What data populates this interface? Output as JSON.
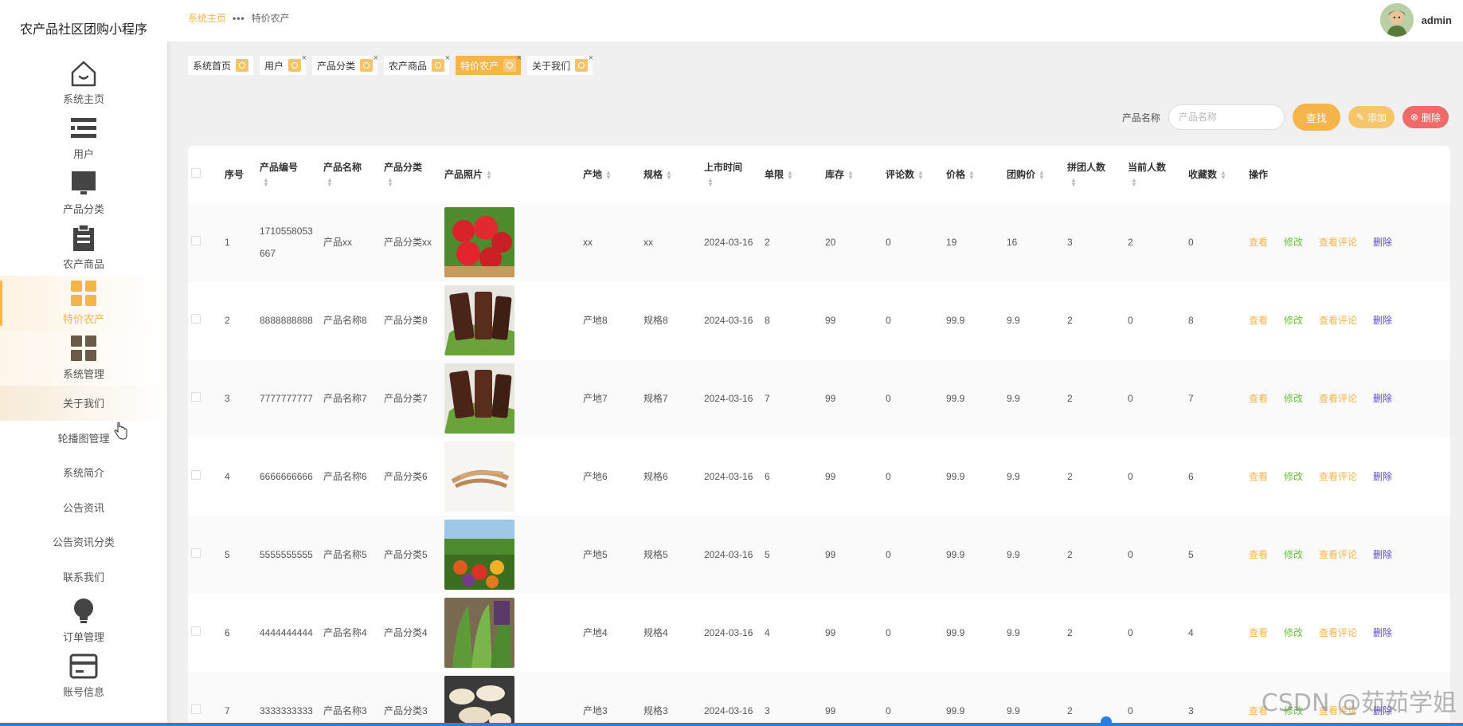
{
  "app": {
    "title": "农产品社区团购小程序"
  },
  "sidebar": {
    "items": [
      {
        "label": "系统主页",
        "icon": "home-icon"
      },
      {
        "label": "用户",
        "icon": "list-icon"
      },
      {
        "label": "产品分类",
        "icon": "monitor-icon"
      },
      {
        "label": "农产商品",
        "icon": "clipboard-icon"
      },
      {
        "label": "特价农产",
        "icon": "grid-icon",
        "active": true
      },
      {
        "label": "系统管理",
        "icon": "grid-icon"
      }
    ],
    "submenu": [
      "关于我们",
      "轮播图管理",
      "系统简介",
      "公告资讯",
      "公告资讯分类",
      "联系我们"
    ],
    "bottom": [
      {
        "label": "订单管理",
        "icon": "bulb-icon"
      },
      {
        "label": "账号信息",
        "icon": "card-icon"
      }
    ]
  },
  "breadcrumb": {
    "home": "系统主页",
    "current": "特价农产"
  },
  "user": {
    "name": "admin"
  },
  "tags": [
    "系统首页",
    "用户",
    "产品分类",
    "农产商品",
    "特价农产",
    "关于我们"
  ],
  "search": {
    "label": "产品名称",
    "placeholder": "产品名称",
    "find": "查找",
    "add": "添加",
    "delete": "删除"
  },
  "table": {
    "headers": [
      "序号",
      "产品编号",
      "产品名称",
      "产品分类",
      "产品照片",
      "产地",
      "规格",
      "上市时间",
      "单限",
      "库存",
      "评论数",
      "价格",
      "团购价",
      "拼团人数",
      "当前人数",
      "收藏数",
      "操作"
    ],
    "actions": [
      "查看",
      "修改",
      "查看评论",
      "删除"
    ],
    "rows": [
      {
        "no": "1",
        "code": "1710558053667",
        "name": "产品xx",
        "category": "产品分类xx",
        "photo": "strawberry",
        "origin": "xx",
        "spec": "xx",
        "date": "2024-03-16",
        "limit": "2",
        "stock": "20",
        "comments": "0",
        "price": "19",
        "group_price": "16",
        "group_size": "3",
        "current": "2",
        "favorites": "0"
      },
      {
        "no": "2",
        "code": "8888888888",
        "name": "产品名称8",
        "category": "产品分类8",
        "photo": "dried-meat",
        "origin": "产地8",
        "spec": "规格8",
        "date": "2024-03-16",
        "limit": "8",
        "stock": "99",
        "comments": "0",
        "price": "99.9",
        "group_price": "9.9",
        "group_size": "2",
        "current": "0",
        "favorites": "8"
      },
      {
        "no": "3",
        "code": "7777777777",
        "name": "产品名称7",
        "category": "产品分类7",
        "photo": "dried-meat",
        "origin": "产地7",
        "spec": "规格7",
        "date": "2024-03-16",
        "limit": "7",
        "stock": "99",
        "comments": "0",
        "price": "99.9",
        "group_price": "9.9",
        "group_size": "2",
        "current": "0",
        "favorites": "7"
      },
      {
        "no": "4",
        "code": "6666666666",
        "name": "产品名称6",
        "category": "产品分类6",
        "photo": "roots",
        "origin": "产地6",
        "spec": "规格6",
        "date": "2024-03-16",
        "limit": "6",
        "stock": "99",
        "comments": "0",
        "price": "99.9",
        "group_price": "9.9",
        "group_size": "2",
        "current": "0",
        "favorites": "6"
      },
      {
        "no": "5",
        "code": "5555555555",
        "name": "产品名称5",
        "category": "产品分类5",
        "photo": "vegetables",
        "origin": "产地5",
        "spec": "规格5",
        "date": "2024-03-16",
        "limit": "5",
        "stock": "99",
        "comments": "0",
        "price": "99.9",
        "group_price": "9.9",
        "group_size": "2",
        "current": "0",
        "favorites": "5"
      },
      {
        "no": "6",
        "code": "4444444444",
        "name": "产品名称4",
        "category": "产品分类4",
        "photo": "greens",
        "origin": "产地4",
        "spec": "规格4",
        "date": "2024-03-16",
        "limit": "4",
        "stock": "99",
        "comments": "0",
        "price": "99.9",
        "group_price": "9.9",
        "group_size": "2",
        "current": "0",
        "favorites": "4"
      },
      {
        "no": "7",
        "code": "3333333333",
        "name": "产品名称3",
        "category": "产品分类3",
        "photo": "slices",
        "origin": "产地3",
        "spec": "规格3",
        "date": "2024-03-16",
        "limit": "3",
        "stock": "99",
        "comments": "0",
        "price": "99.9",
        "group_price": "9.9",
        "group_size": "2",
        "current": "0",
        "favorites": "3"
      }
    ]
  },
  "watermark": "CSDN @茹茹学姐",
  "colors": {
    "accent": "#f5b54a",
    "edit": "#67c23a",
    "danger": "#f06a6a",
    "remove": "#5a4bd6"
  }
}
